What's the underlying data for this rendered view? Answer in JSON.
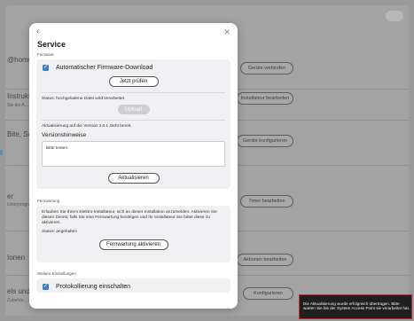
{
  "background": {
    "rows": [
      {
        "label": "@home",
        "sub": "",
        "button": "Geräte verbinden"
      },
      {
        "label": "Instruktionen",
        "sub": "Sie die A...",
        "button": "Installateur bearbeiten"
      },
      {
        "label": "Bite, Soc",
        "sub": "",
        "button": "Geräte konfigurieren"
      },
      {
        "label": "er",
        "sub": "Unterprogramm...",
        "button": "Timer bearbeiten"
      },
      {
        "label": "Ionen",
        "sub": "",
        "button": "Aktionen bearbeiten"
      },
      {
        "label": "els und",
        "sub": "Zubehör...",
        "button": "Konfigurieren"
      }
    ]
  },
  "modal": {
    "title": "Service",
    "back_icon": "chevron-left-icon",
    "close_icon": "close-icon",
    "firmware": {
      "section_label": "Firmware",
      "auto_download_label": "Automatischer Firmware-Download",
      "auto_download_checked": true,
      "check_button": "Jetzt prüfen",
      "status_text": "Status: hochgeladene Datei wird verarbeitet",
      "upload_button": "Upload",
      "update_available": "Aktualisierung auf die Version 3.0.1 steht bereit.",
      "release_notes_title": "Versionshinweise",
      "release_notes_text": "Bitte testen",
      "update_button": "Aktualisieren"
    },
    "remote": {
      "section_label": "Fernwartung",
      "description": "Erlauben Sie Ihrem Elektro-Installateur, sich an dieser Installation anzumelden. Aktivieren Sie diesen Dienst, falls Sie eine Fernwartung benötigen und Ihr Installateur Sie bittet diese zu aktivieren.",
      "status_text": "Status: angehalten",
      "activate_button": "Fernwartung aktivieren"
    },
    "more": {
      "section_label": "Weitere Einstellungen",
      "logging_label": "Protokollierung einschalten",
      "logging_checked": true
    }
  },
  "toast": {
    "text": "Die Aktualisierung wurde erfolgreich übertragen. Bitte warten Sie bis der System Access Point sie verarbeitet hat."
  },
  "colors": {
    "accent": "#3b7fc4",
    "toast_border": "#d21f1f"
  }
}
